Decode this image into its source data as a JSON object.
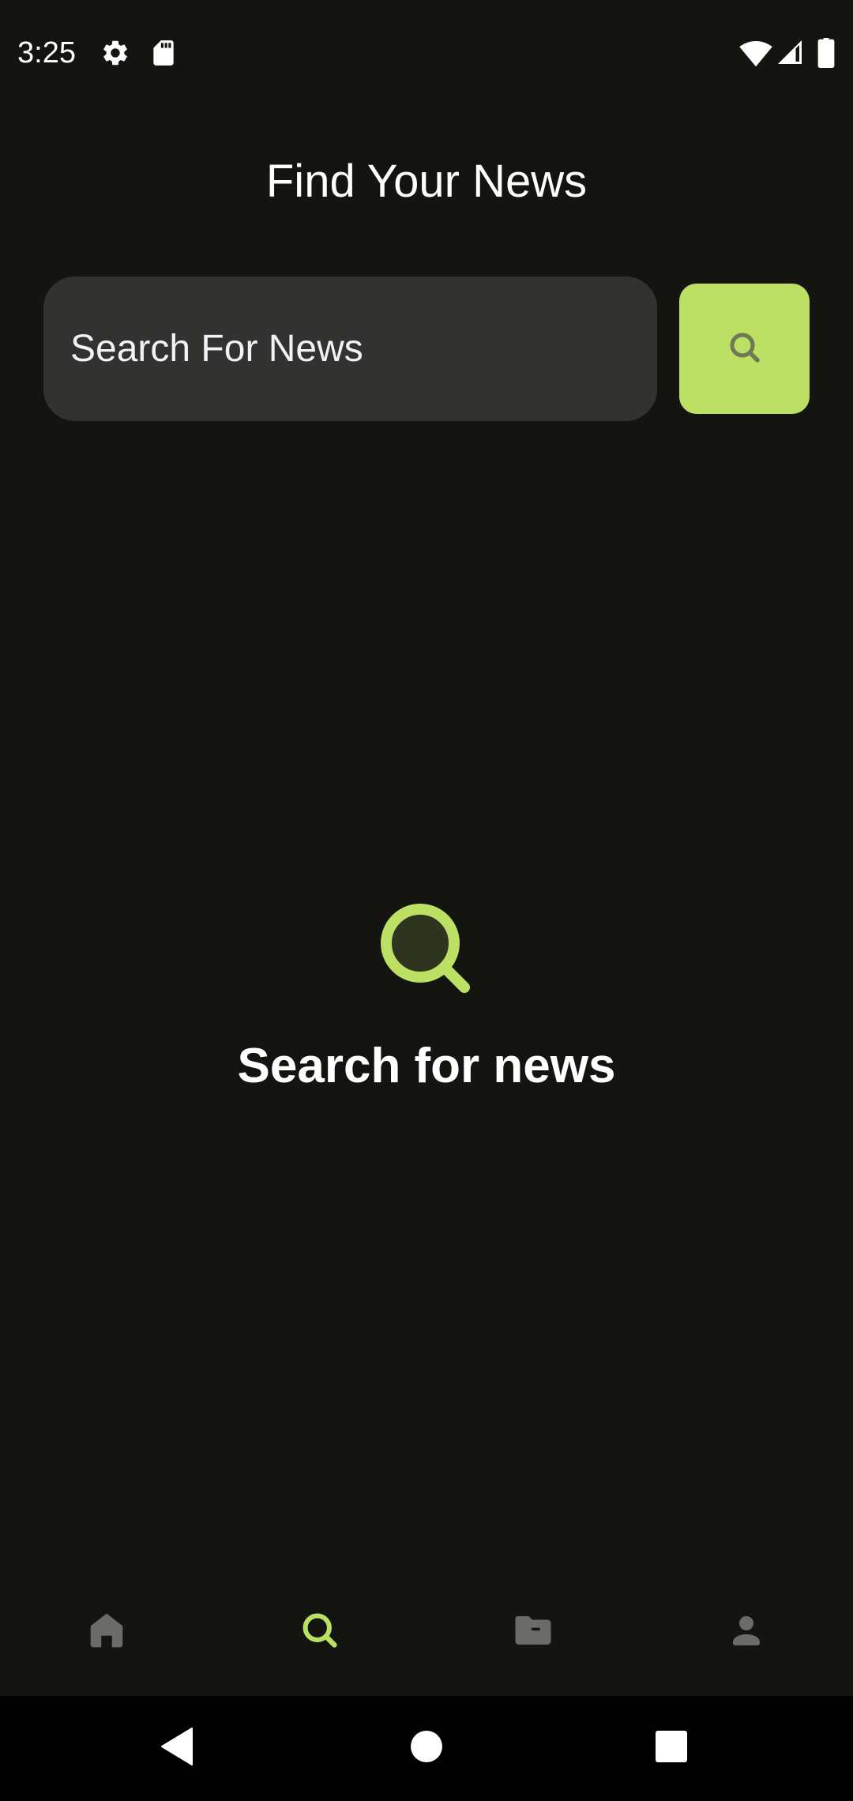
{
  "status_bar": {
    "time": "3:25",
    "icons": [
      "gear-icon",
      "sd-card-icon",
      "wifi-icon",
      "signal-icon",
      "battery-icon"
    ]
  },
  "header": {
    "title": "Find Your News"
  },
  "search": {
    "placeholder": "Search For News",
    "value": "",
    "button_icon": "search-icon"
  },
  "empty_state": {
    "icon": "search-icon",
    "message": "Search for news"
  },
  "bottom_nav": {
    "items": [
      {
        "icon": "home-icon",
        "active": false
      },
      {
        "icon": "search-icon",
        "active": true
      },
      {
        "icon": "folder-icon",
        "active": false
      },
      {
        "icon": "profile-icon",
        "active": false
      }
    ]
  },
  "system_nav": {
    "buttons": [
      "back-icon",
      "home-circle-icon",
      "recents-icon"
    ]
  },
  "colors": {
    "background": "#141511",
    "accent": "#bce063",
    "input_bg": "#323230",
    "inactive_icon": "#6b6b69"
  }
}
